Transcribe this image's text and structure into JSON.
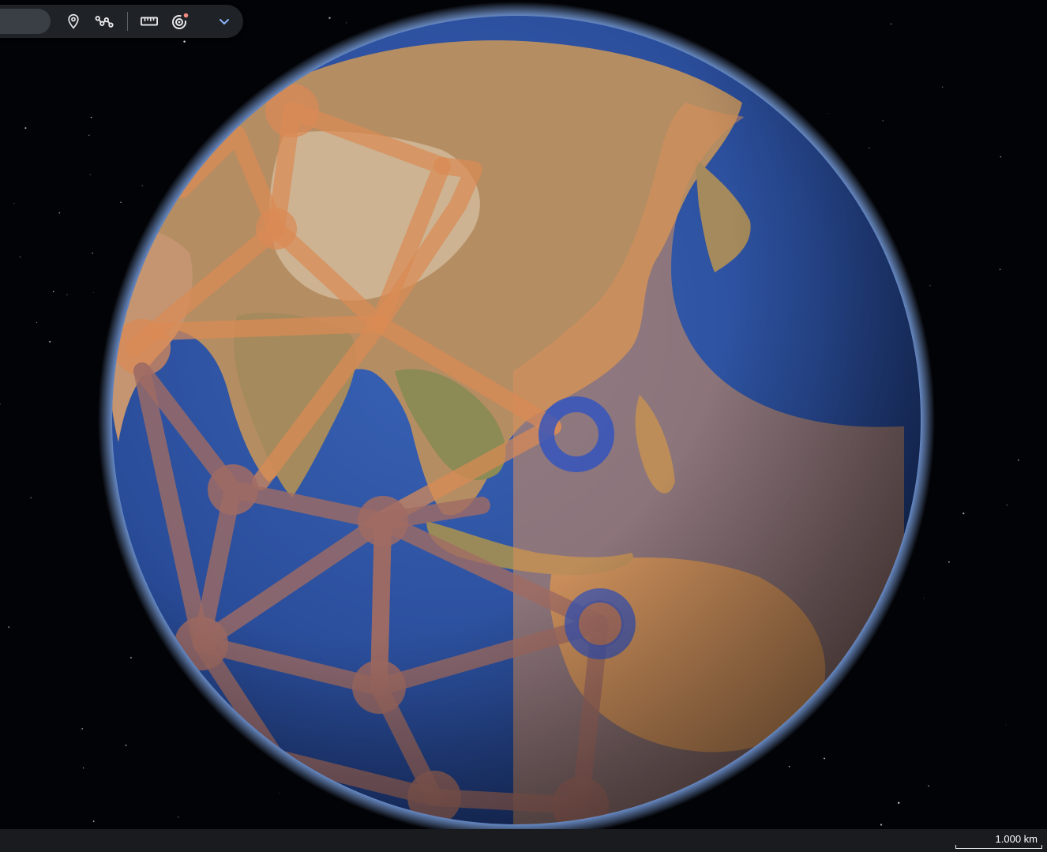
{
  "toolbar": {
    "buttons": [
      {
        "id": "placemark",
        "icon": "placemark-icon"
      },
      {
        "id": "path",
        "icon": "path-icon"
      },
      {
        "id": "measure",
        "icon": "ruler-icon"
      },
      {
        "id": "timelapse",
        "icon": "timelapse-icon"
      },
      {
        "id": "more",
        "icon": "chevron-down-icon"
      }
    ],
    "notification_dot_color": "#f28b82",
    "icon_color": "#e8eaed",
    "chevron_color": "#8ab4f8"
  },
  "status_bar": {
    "scale_label": "1.000 km"
  },
  "globe": {
    "ocean_color": "#2c4f9c",
    "land_colors": [
      "#b68e64",
      "#c9a57c",
      "#8a7a55"
    ],
    "overlay_color": "#d98a55",
    "atmosphere_color": "#6f9be3"
  }
}
